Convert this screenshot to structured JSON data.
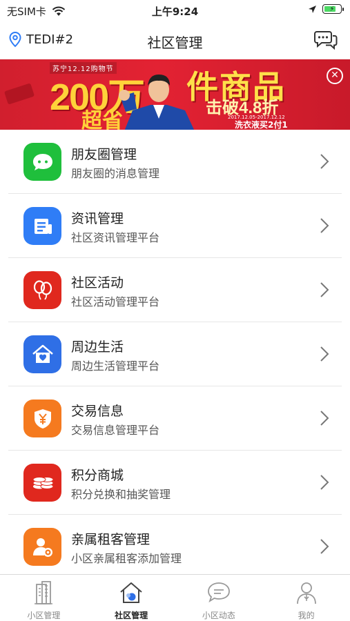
{
  "status_bar": {
    "carrier": "无SIM卡",
    "time": "上午9:24"
  },
  "nav": {
    "location": "TEDI#2",
    "title": "社区管理"
  },
  "banner": {
    "tag": "苏宁12.12购物节",
    "big_text": "200万",
    "sub_text": "超省",
    "headline": "件商品",
    "breakthrough": "击破4.8折",
    "promo": "洗衣液买2付1",
    "date": "2017.12.05-2017.12.12"
  },
  "menu": [
    {
      "title": "朋友圈管理",
      "subtitle": "朋友圈的消息管理",
      "icon": "chat-bubble-icon",
      "color": "#1fbf3c"
    },
    {
      "title": "资讯管理",
      "subtitle": "社区资讯管理平台",
      "icon": "news-doc-icon",
      "color": "#2f7df6"
    },
    {
      "title": "社区活动",
      "subtitle": "社区活动管理平台",
      "icon": "balloons-icon",
      "color": "#e0281e"
    },
    {
      "title": "周边生活",
      "subtitle": "周边生活管理平台",
      "icon": "home-heart-icon",
      "color": "#2f6fe6"
    },
    {
      "title": "交易信息",
      "subtitle": "交易信息管理平台",
      "icon": "yuan-shield-icon",
      "color": "#f57a1f"
    },
    {
      "title": "积分商城",
      "subtitle": "积分兑换和抽奖管理",
      "icon": "coin-stack-icon",
      "color": "#e0281e"
    },
    {
      "title": "亲属租客管理",
      "subtitle": "小区亲属租客添加管理",
      "icon": "user-gear-icon",
      "color": "#f57a1f"
    }
  ],
  "tabs": [
    {
      "label": "小区管理",
      "icon": "building-icon",
      "active": false
    },
    {
      "label": "社区管理",
      "icon": "community-home-icon",
      "active": true
    },
    {
      "label": "小区动态",
      "icon": "chat-feed-icon",
      "active": false
    },
    {
      "label": "我的",
      "icon": "profile-icon",
      "active": false
    }
  ]
}
